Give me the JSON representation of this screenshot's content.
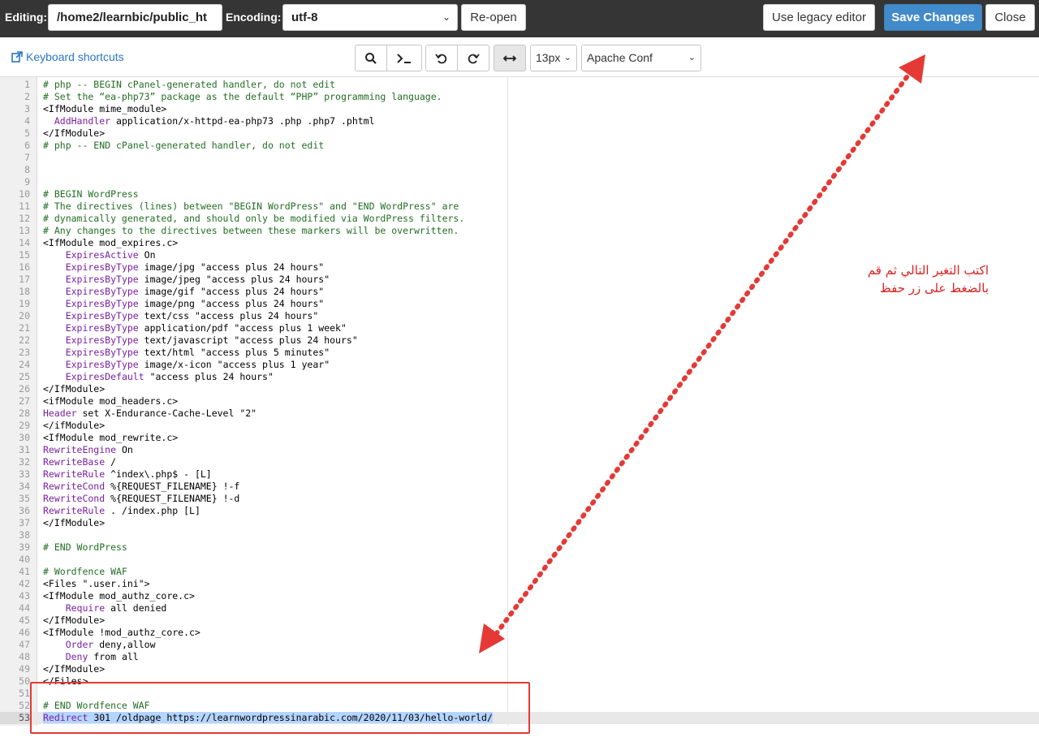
{
  "topbar": {
    "editing_label": "Editing:",
    "file_path": "/home2/learnbic/public_ht",
    "encoding_label": "Encoding:",
    "encoding_value": "utf-8",
    "reopen_label": "Re-open",
    "legacy_label": "Use legacy editor",
    "save_label": "Save Changes",
    "close_label": "Close",
    "bar_color": "#353535",
    "primary_color": "#428bca"
  },
  "toolbar": {
    "keyboard_shortcuts": "Keyboard shortcuts",
    "font_size": "13px",
    "mode": "Apache Conf",
    "icons": [
      "search-icon",
      "terminal-icon",
      "undo-icon",
      "redo-icon",
      "wrap-toggle-icon"
    ]
  },
  "code": {
    "lines": [
      {
        "n": "1",
        "t": "# php -- BEGIN cPanel-generated handler, do not edit"
      },
      {
        "n": "2",
        "t": "# Set the “ea-php73” package as the default “PHP” programming language."
      },
      {
        "n": "3",
        "t": "<IfModule mime_module>"
      },
      {
        "n": "4",
        "t": "  AddHandler application/x-httpd-ea-php73 .php .php7 .phtml"
      },
      {
        "n": "5",
        "t": "</IfModule>"
      },
      {
        "n": "6",
        "t": "# php -- END cPanel-generated handler, do not edit"
      },
      {
        "n": "7",
        "t": ""
      },
      {
        "n": "8",
        "t": ""
      },
      {
        "n": "9",
        "t": ""
      },
      {
        "n": "10",
        "t": "# BEGIN WordPress"
      },
      {
        "n": "11",
        "t": "# The directives (lines) between \"BEGIN WordPress\" and \"END WordPress\" are"
      },
      {
        "n": "12",
        "t": "# dynamically generated, and should only be modified via WordPress filters."
      },
      {
        "n": "13",
        "t": "# Any changes to the directives between these markers will be overwritten."
      },
      {
        "n": "14",
        "t": "<IfModule mod_expires.c>"
      },
      {
        "n": "15",
        "t": "    ExpiresActive On"
      },
      {
        "n": "16",
        "t": "    ExpiresByType image/jpg \"access plus 24 hours\""
      },
      {
        "n": "17",
        "t": "    ExpiresByType image/jpeg \"access plus 24 hours\""
      },
      {
        "n": "18",
        "t": "    ExpiresByType image/gif \"access plus 24 hours\""
      },
      {
        "n": "19",
        "t": "    ExpiresByType image/png \"access plus 24 hours\""
      },
      {
        "n": "20",
        "t": "    ExpiresByType text/css \"access plus 24 hours\""
      },
      {
        "n": "21",
        "t": "    ExpiresByType application/pdf \"access plus 1 week\""
      },
      {
        "n": "22",
        "t": "    ExpiresByType text/javascript \"access plus 24 hours\""
      },
      {
        "n": "23",
        "t": "    ExpiresByType text/html \"access plus 5 minutes\""
      },
      {
        "n": "24",
        "t": "    ExpiresByType image/x-icon \"access plus 1 year\""
      },
      {
        "n": "25",
        "t": "    ExpiresDefault \"access plus 24 hours\""
      },
      {
        "n": "26",
        "t": "</IfModule>"
      },
      {
        "n": "27",
        "t": "<ifModule mod_headers.c>"
      },
      {
        "n": "28",
        "t": "Header set X-Endurance-Cache-Level \"2\""
      },
      {
        "n": "29",
        "t": "</ifModule>"
      },
      {
        "n": "30",
        "t": "<IfModule mod_rewrite.c>"
      },
      {
        "n": "31",
        "t": "RewriteEngine On"
      },
      {
        "n": "32",
        "t": "RewriteBase /"
      },
      {
        "n": "33",
        "t": "RewriteRule ^index\\.php$ - [L]"
      },
      {
        "n": "34",
        "t": "RewriteCond %{REQUEST_FILENAME} !-f"
      },
      {
        "n": "35",
        "t": "RewriteCond %{REQUEST_FILENAME} !-d"
      },
      {
        "n": "36",
        "t": "RewriteRule . /index.php [L]"
      },
      {
        "n": "37",
        "t": "</IfModule>"
      },
      {
        "n": "38",
        "t": ""
      },
      {
        "n": "39",
        "t": "# END WordPress"
      },
      {
        "n": "40",
        "t": ""
      },
      {
        "n": "41",
        "t": "# Wordfence WAF"
      },
      {
        "n": "42",
        "t": "<Files \".user.ini\">"
      },
      {
        "n": "43",
        "t": "<IfModule mod_authz_core.c>"
      },
      {
        "n": "44",
        "t": "    Require all denied"
      },
      {
        "n": "45",
        "t": "</IfModule>"
      },
      {
        "n": "46",
        "t": "<IfModule !mod_authz_core.c>"
      },
      {
        "n": "47",
        "t": "    Order deny,allow"
      },
      {
        "n": "48",
        "t": "    Deny from all"
      },
      {
        "n": "49",
        "t": "</IfModule>"
      },
      {
        "n": "50",
        "t": "</Files>"
      },
      {
        "n": "51",
        "t": ""
      },
      {
        "n": "52",
        "t": "# END Wordfence WAF"
      },
      {
        "n": "53",
        "t": "Redirect 301 /oldpage https://learnwordpressinarabic.com/2020/11/03/hello-world/"
      }
    ],
    "current_line": "53"
  },
  "annotation": {
    "note_line1": "اكتب التغير التالي ثم قم",
    "note_line2": "بالضغط على زر حفظ",
    "color": "#e53935"
  }
}
